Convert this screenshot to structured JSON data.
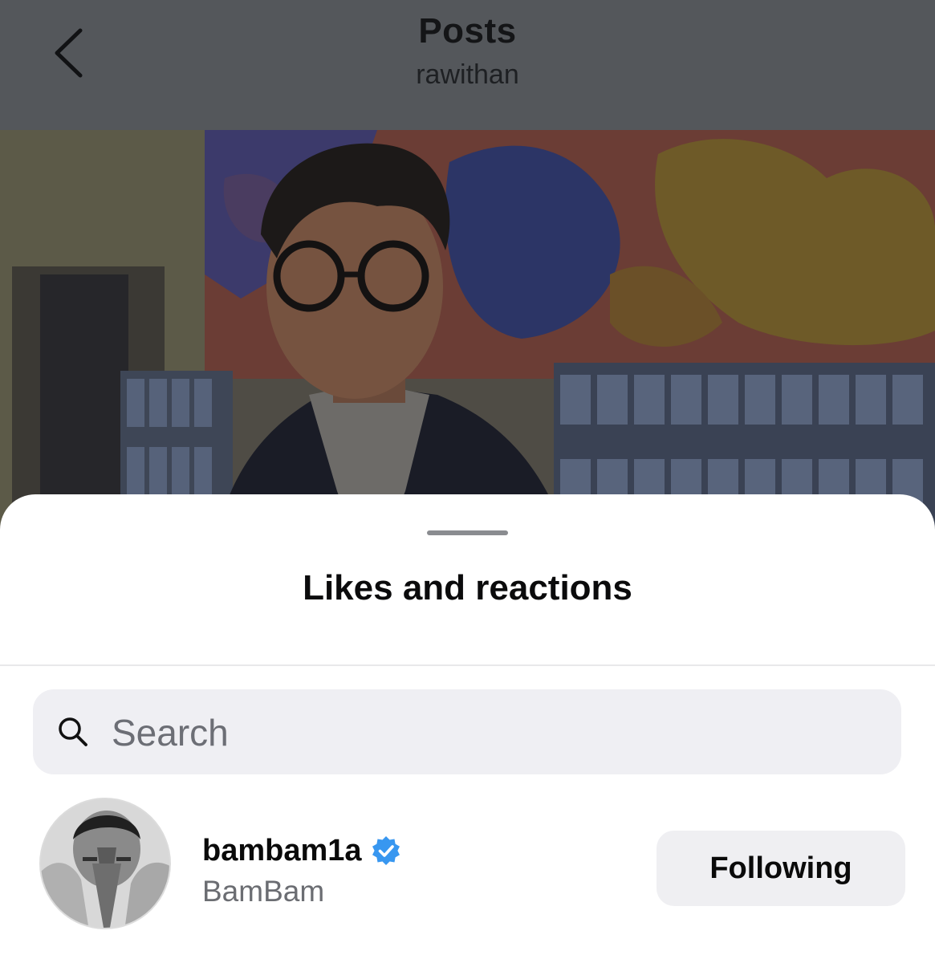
{
  "header": {
    "title": "Posts",
    "subtitle": "rawithan",
    "back_icon": "chevron-left-icon"
  },
  "post": {
    "image_description": ""
  },
  "sheet": {
    "title": "Likes and reactions",
    "search": {
      "placeholder": "Search",
      "value": "",
      "icon": "search-icon"
    },
    "users": [
      {
        "username": "bambam1a",
        "full_name": "BamBam",
        "verified": true,
        "action_label": "Following"
      }
    ]
  },
  "colors": {
    "verified_badge": "#3897f0",
    "header_dim": "#54575b",
    "search_bg": "#efeff3",
    "button_bg": "#efeff2"
  }
}
